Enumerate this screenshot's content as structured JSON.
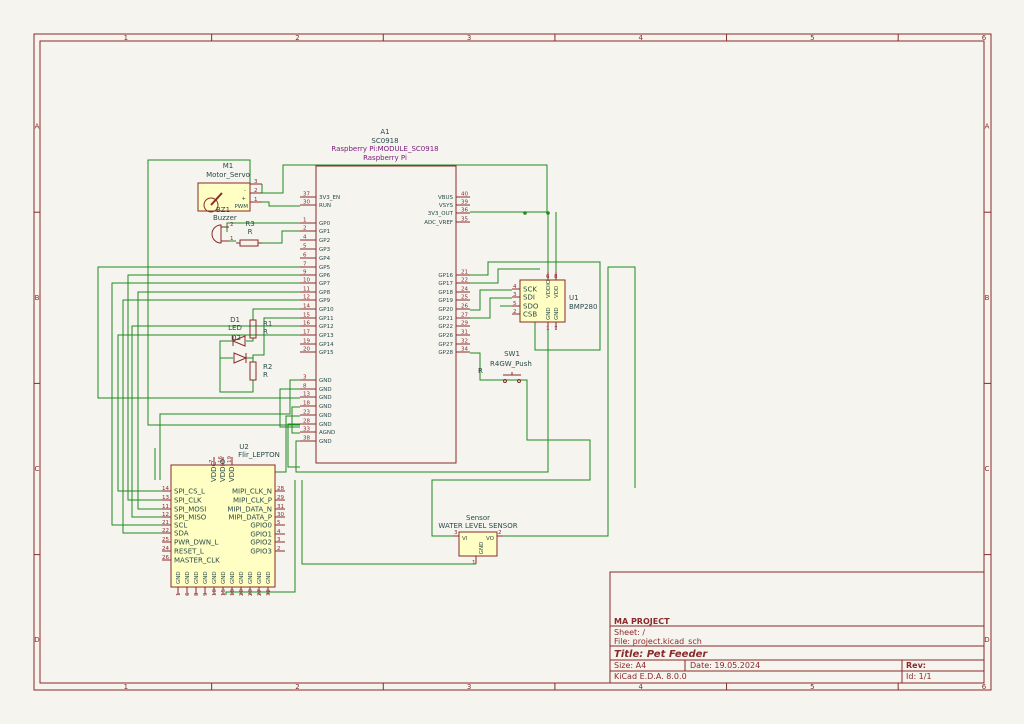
{
  "frame": {
    "cols": [
      "1",
      "2",
      "3",
      "4",
      "5",
      "6"
    ],
    "rows": [
      "A",
      "B",
      "C",
      "D"
    ]
  },
  "components": {
    "a1": {
      "ref": "A1",
      "value": "SC0918",
      "lib": "Raspberry Pi:MODULE_SC0918",
      "name": "Raspberry Pi"
    },
    "m1": {
      "ref": "M1",
      "value": "Motor_Servo",
      "pin_label": "PWM",
      "plus": "+",
      "minus": "-"
    },
    "bz1": {
      "ref": "BZ1",
      "value": "Buzzer"
    },
    "r3": {
      "ref": "R3",
      "value": "R"
    },
    "r1": {
      "ref": "R1",
      "value": "R"
    },
    "r2": {
      "ref": "R2",
      "value": "R"
    },
    "d1": {
      "ref": "D1",
      "value": "LED"
    },
    "d2": {
      "ref": "D2"
    },
    "u1": {
      "ref": "U1",
      "value": "BMP280"
    },
    "u2": {
      "ref": "U2",
      "value": "Flir_LEPTON"
    },
    "sw1": {
      "ref": "SW1",
      "value": "R4GW_Push",
      "extra": "R"
    },
    "sensor": {
      "ref": "Sensor",
      "value": "WATER LEVEL SENSOR"
    }
  },
  "pi_left": [
    {
      "n": "37",
      "l": "3V3_EN"
    },
    {
      "n": "30",
      "l": "RUN"
    },
    {
      "n": "1",
      "l": "GP0"
    },
    {
      "n": "2",
      "l": "GP1"
    },
    {
      "n": "4",
      "l": "GP2"
    },
    {
      "n": "5",
      "l": "GP3"
    },
    {
      "n": "6",
      "l": "GP4"
    },
    {
      "n": "7",
      "l": "GP5"
    },
    {
      "n": "9",
      "l": "GP6"
    },
    {
      "n": "10",
      "l": "GP7"
    },
    {
      "n": "11",
      "l": "GP8"
    },
    {
      "n": "12",
      "l": "GP9"
    },
    {
      "n": "14",
      "l": "GP10"
    },
    {
      "n": "15",
      "l": "GP11"
    },
    {
      "n": "16",
      "l": "GP12"
    },
    {
      "n": "17",
      "l": "GP13"
    },
    {
      "n": "19",
      "l": "GP14"
    },
    {
      "n": "20",
      "l": "GP15"
    },
    {
      "n": "3",
      "l": "GND"
    },
    {
      "n": "8",
      "l": "GND"
    },
    {
      "n": "13",
      "l": "GND"
    },
    {
      "n": "18",
      "l": "GND"
    },
    {
      "n": "23",
      "l": "GND"
    },
    {
      "n": "28",
      "l": "GND"
    },
    {
      "n": "33",
      "l": "AGND"
    },
    {
      "n": "38",
      "l": "GND"
    }
  ],
  "pi_right": [
    {
      "n": "40",
      "l": "VBUS"
    },
    {
      "n": "39",
      "l": "VSYS"
    },
    {
      "n": "36",
      "l": "3V3_OUT"
    },
    {
      "n": "35",
      "l": "ADC_VREF"
    },
    {
      "n": "21",
      "l": "GP16"
    },
    {
      "n": "22",
      "l": "GP17"
    },
    {
      "n": "24",
      "l": "GP18"
    },
    {
      "n": "25",
      "l": "GP19"
    },
    {
      "n": "26",
      "l": "GP20"
    },
    {
      "n": "27",
      "l": "GP21"
    },
    {
      "n": "29",
      "l": "GP22"
    },
    {
      "n": "31",
      "l": "GP26"
    },
    {
      "n": "32",
      "l": "GP27"
    },
    {
      "n": "34",
      "l": "GP28"
    }
  ],
  "bmp_left": [
    {
      "n": "4",
      "l": "SCK"
    },
    {
      "n": "3",
      "l": "SDI"
    },
    {
      "n": "5",
      "l": "SDO"
    },
    {
      "n": "2",
      "l": "CSB"
    }
  ],
  "bmp_top": [
    {
      "n": "6",
      "l": "VDDIO"
    },
    {
      "n": "8",
      "l": "VDD"
    }
  ],
  "bmp_bottom": [
    {
      "n": "1",
      "l": "GND"
    },
    {
      "n": "7",
      "l": "GND"
    }
  ],
  "lep_left": [
    {
      "n": "14",
      "l": "SPI_CS_L"
    },
    {
      "n": "13",
      "l": "SPI_CLK"
    },
    {
      "n": "11",
      "l": "SPI_MOSI"
    },
    {
      "n": "12",
      "l": "SPI_MISO"
    },
    {
      "n": "21",
      "l": "SCL"
    },
    {
      "n": "22",
      "l": "SDA"
    },
    {
      "n": "25",
      "l": "PWR_DWN_L"
    },
    {
      "n": "24",
      "l": "RESET_L"
    },
    {
      "n": "26",
      "l": "MASTER_CLK"
    }
  ],
  "lep_right": [
    {
      "n": "28",
      "l": "MIPI_CLK_N"
    },
    {
      "n": "29",
      "l": "MIPI_CLK_P"
    },
    {
      "n": "31",
      "l": "MIPI_DATA_N"
    },
    {
      "n": "30",
      "l": "MIPI_DATA_P"
    },
    {
      "n": "5",
      "l": "GPIO0"
    },
    {
      "n": "4",
      "l": "GPIO1"
    },
    {
      "n": "3",
      "l": "GPIO2"
    },
    {
      "n": "2",
      "l": "GPIO3"
    }
  ],
  "lep_top": [
    {
      "n": "7",
      "l": "VDDC"
    },
    {
      "n": "16",
      "l": "VDDIO"
    },
    {
      "n": "19",
      "l": "VDD"
    }
  ],
  "lep_bottom": [
    {
      "n": "1",
      "l": "GND"
    },
    {
      "n": "6",
      "l": "GND"
    },
    {
      "n": "8",
      "l": "GND"
    },
    {
      "n": "9",
      "l": "GND"
    },
    {
      "n": "10",
      "l": "GND"
    },
    {
      "n": "15",
      "l": "GND"
    },
    {
      "n": "18",
      "l": "GND"
    },
    {
      "n": "20",
      "l": "GND"
    },
    {
      "n": "23",
      "l": "GND"
    },
    {
      "n": "27",
      "l": "GND"
    },
    {
      "n": "32",
      "l": "GND"
    }
  ],
  "sensor_pins": {
    "vi": "VI",
    "vo": "VO",
    "gnd": "GND",
    "n_vi": "3",
    "n_vo": "2",
    "n_gnd": "1"
  },
  "servo_pins": [
    "3",
    "2",
    "1"
  ],
  "small_pins": {
    "bz_2": "2",
    "bz_1": "1",
    "sw_1": "1",
    "sw_2": "2"
  },
  "title_block": {
    "company": "MA PROJECT",
    "sheet": "Sheet: /",
    "file": "File: project.kicad_sch",
    "title": "Title: Pet Feeder",
    "size": "Size: A4",
    "date": "Date: 19.05.2024",
    "rev": "Rev:",
    "tool": "KiCad E.D.A. 8.0.0",
    "id": "Id: 1/1"
  },
  "colors": {
    "frame": "#8a2a2a",
    "wire": "#1f8a1f",
    "body": "#ffffc4",
    "paper": "#f5f4ef"
  }
}
